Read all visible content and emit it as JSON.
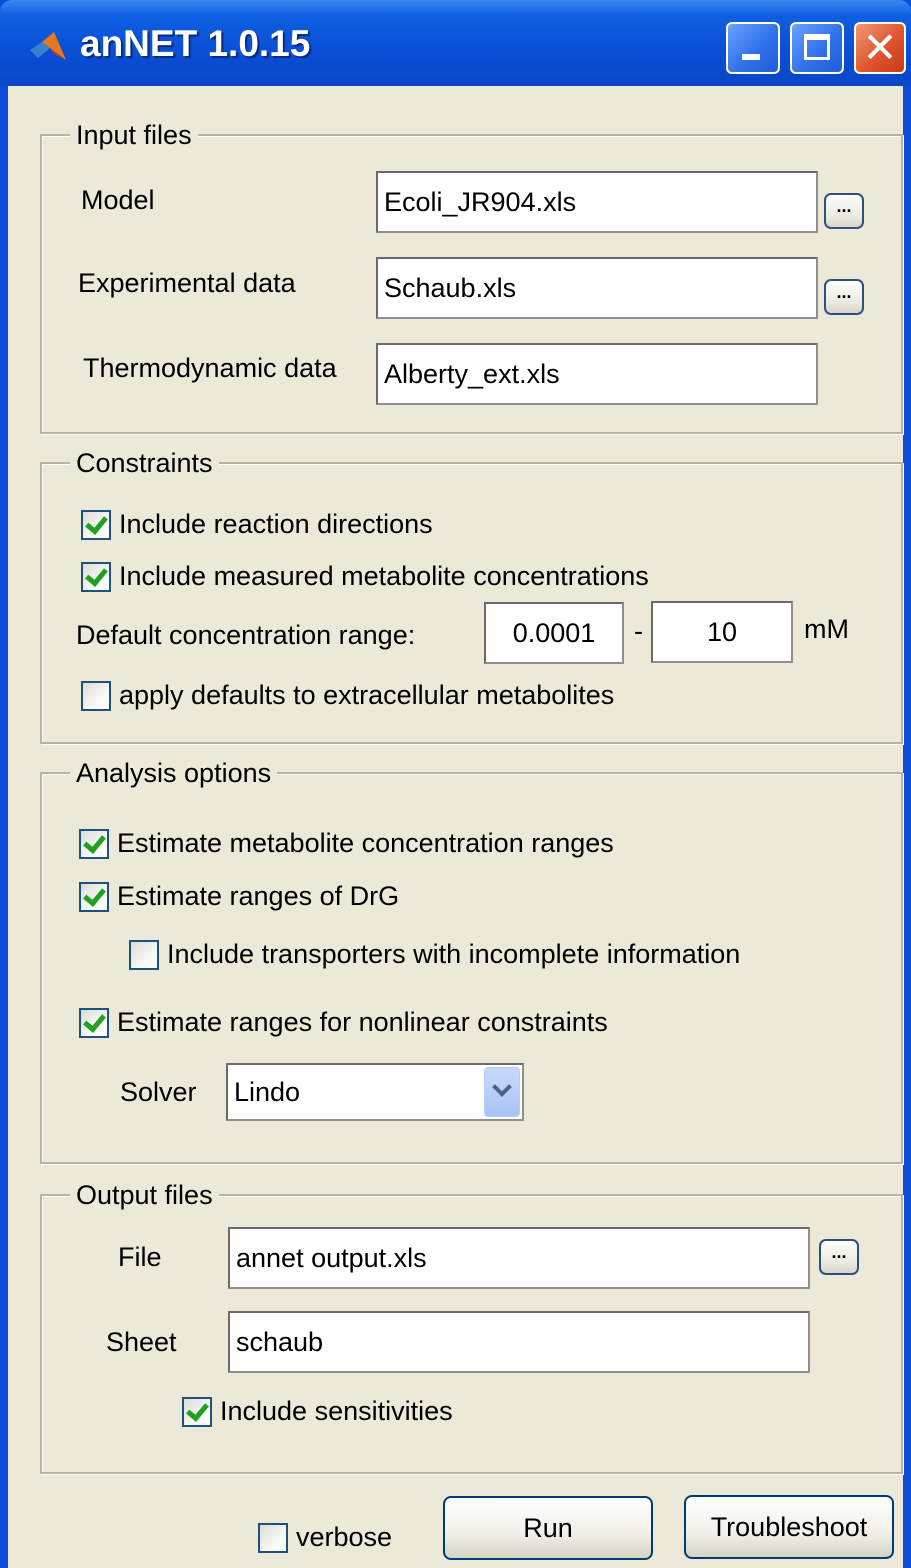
{
  "window": {
    "title": "anNET 1.0.15",
    "close_glyph": "✕"
  },
  "input_files": {
    "legend": "Input files",
    "model_label": "Model",
    "model_value": "Ecoli_JR904.xls",
    "exp_label": "Experimental data",
    "exp_value": "Schaub.xls",
    "thermo_label": "Thermodynamic data",
    "thermo_value": "Alberty_ext.xls",
    "browse_label": "..."
  },
  "constraints": {
    "legend": "Constraints",
    "include_directions": {
      "label": "Include reaction directions",
      "checked": true
    },
    "include_measured": {
      "label": "Include measured metabolite concentrations",
      "checked": true
    },
    "range_label": "Default concentration range:",
    "range_min": "0.0001",
    "range_dash": "-",
    "range_max": "10",
    "range_unit": "mM",
    "apply_defaults": {
      "label": "apply defaults to extracellular metabolites",
      "checked": false
    }
  },
  "analysis": {
    "legend": "Analysis options",
    "estimate_conc": {
      "label": "Estimate metabolite concentration ranges",
      "checked": true
    },
    "estimate_drg": {
      "label": "Estimate ranges of DrG",
      "checked": true
    },
    "include_transporters": {
      "label": "Include transporters with incomplete information",
      "checked": false
    },
    "estimate_nonlinear": {
      "label": "Estimate ranges for nonlinear constraints",
      "checked": true
    },
    "solver_label": "Solver",
    "solver_value": "Lindo"
  },
  "output": {
    "legend": "Output files",
    "file_label": "File",
    "file_value": "annet output.xls",
    "sheet_label": "Sheet",
    "sheet_value": "schaub",
    "include_sensitivities": {
      "label": "Include sensitivities",
      "checked": true
    }
  },
  "footer": {
    "verbose": {
      "label": "verbose",
      "checked": false
    },
    "run_label": "Run",
    "troubleshoot_label": "Troubleshoot"
  }
}
